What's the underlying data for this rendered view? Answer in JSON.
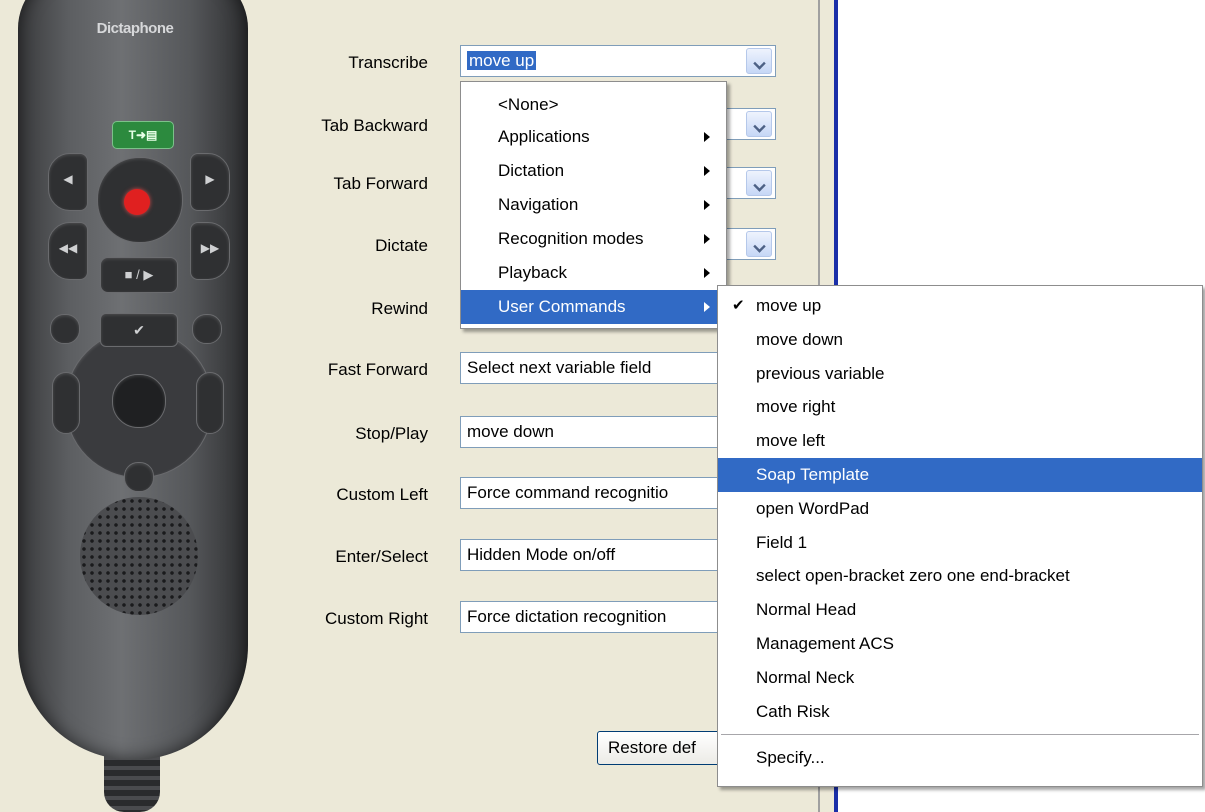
{
  "device": {
    "brand": "Dictaphone",
    "green_button_label": "T➜▤",
    "stop_play_label": "■ / ▶",
    "check_label": "✔"
  },
  "form": {
    "rows": [
      {
        "label": "Transcribe",
        "value": "move up"
      },
      {
        "label": "Tab Backward",
        "value": ""
      },
      {
        "label": "Tab Forward",
        "value": ""
      },
      {
        "label": "Dictate",
        "value": ""
      },
      {
        "label": "Rewind",
        "value": ""
      },
      {
        "label": "Fast Forward",
        "value": "Select next variable field"
      },
      {
        "label": "Stop/Play",
        "value": "move down"
      },
      {
        "label": "Custom Left",
        "value": "Force command recognitio"
      },
      {
        "label": "Enter/Select",
        "value": "Hidden Mode on/off"
      },
      {
        "label": "Custom Right",
        "value": "Force dictation recognition"
      }
    ],
    "restore_button": "Restore def"
  },
  "category_menu": {
    "items": [
      {
        "label": "<None>",
        "submenu": false
      },
      {
        "label": "Applications",
        "submenu": true
      },
      {
        "label": "Dictation",
        "submenu": true
      },
      {
        "label": "Navigation",
        "submenu": true
      },
      {
        "label": "Recognition modes",
        "submenu": true
      },
      {
        "label": "Playback",
        "submenu": true
      },
      {
        "label": "User Commands",
        "submenu": true
      }
    ],
    "active_item": "User Commands"
  },
  "user_commands_menu": {
    "items": [
      {
        "label": "move up",
        "checked": true
      },
      {
        "label": "move down"
      },
      {
        "label": "previous variable"
      },
      {
        "label": "move right"
      },
      {
        "label": "move left"
      },
      {
        "label": "Soap Template",
        "highlighted": true
      },
      {
        "label": "open WordPad"
      },
      {
        "label": "Field 1"
      },
      {
        "label": "select open-bracket zero one end-bracket"
      },
      {
        "label": "Normal Head"
      },
      {
        "label": "Management ACS"
      },
      {
        "label": "Normal Neck"
      },
      {
        "label": "Cath Risk"
      }
    ],
    "specify_label": "Specify...",
    "check_glyph": "✔"
  },
  "colors": {
    "dialog_bg": "#ece9d8",
    "highlight": "#316ac5",
    "window_border": "#1a2fa8"
  }
}
